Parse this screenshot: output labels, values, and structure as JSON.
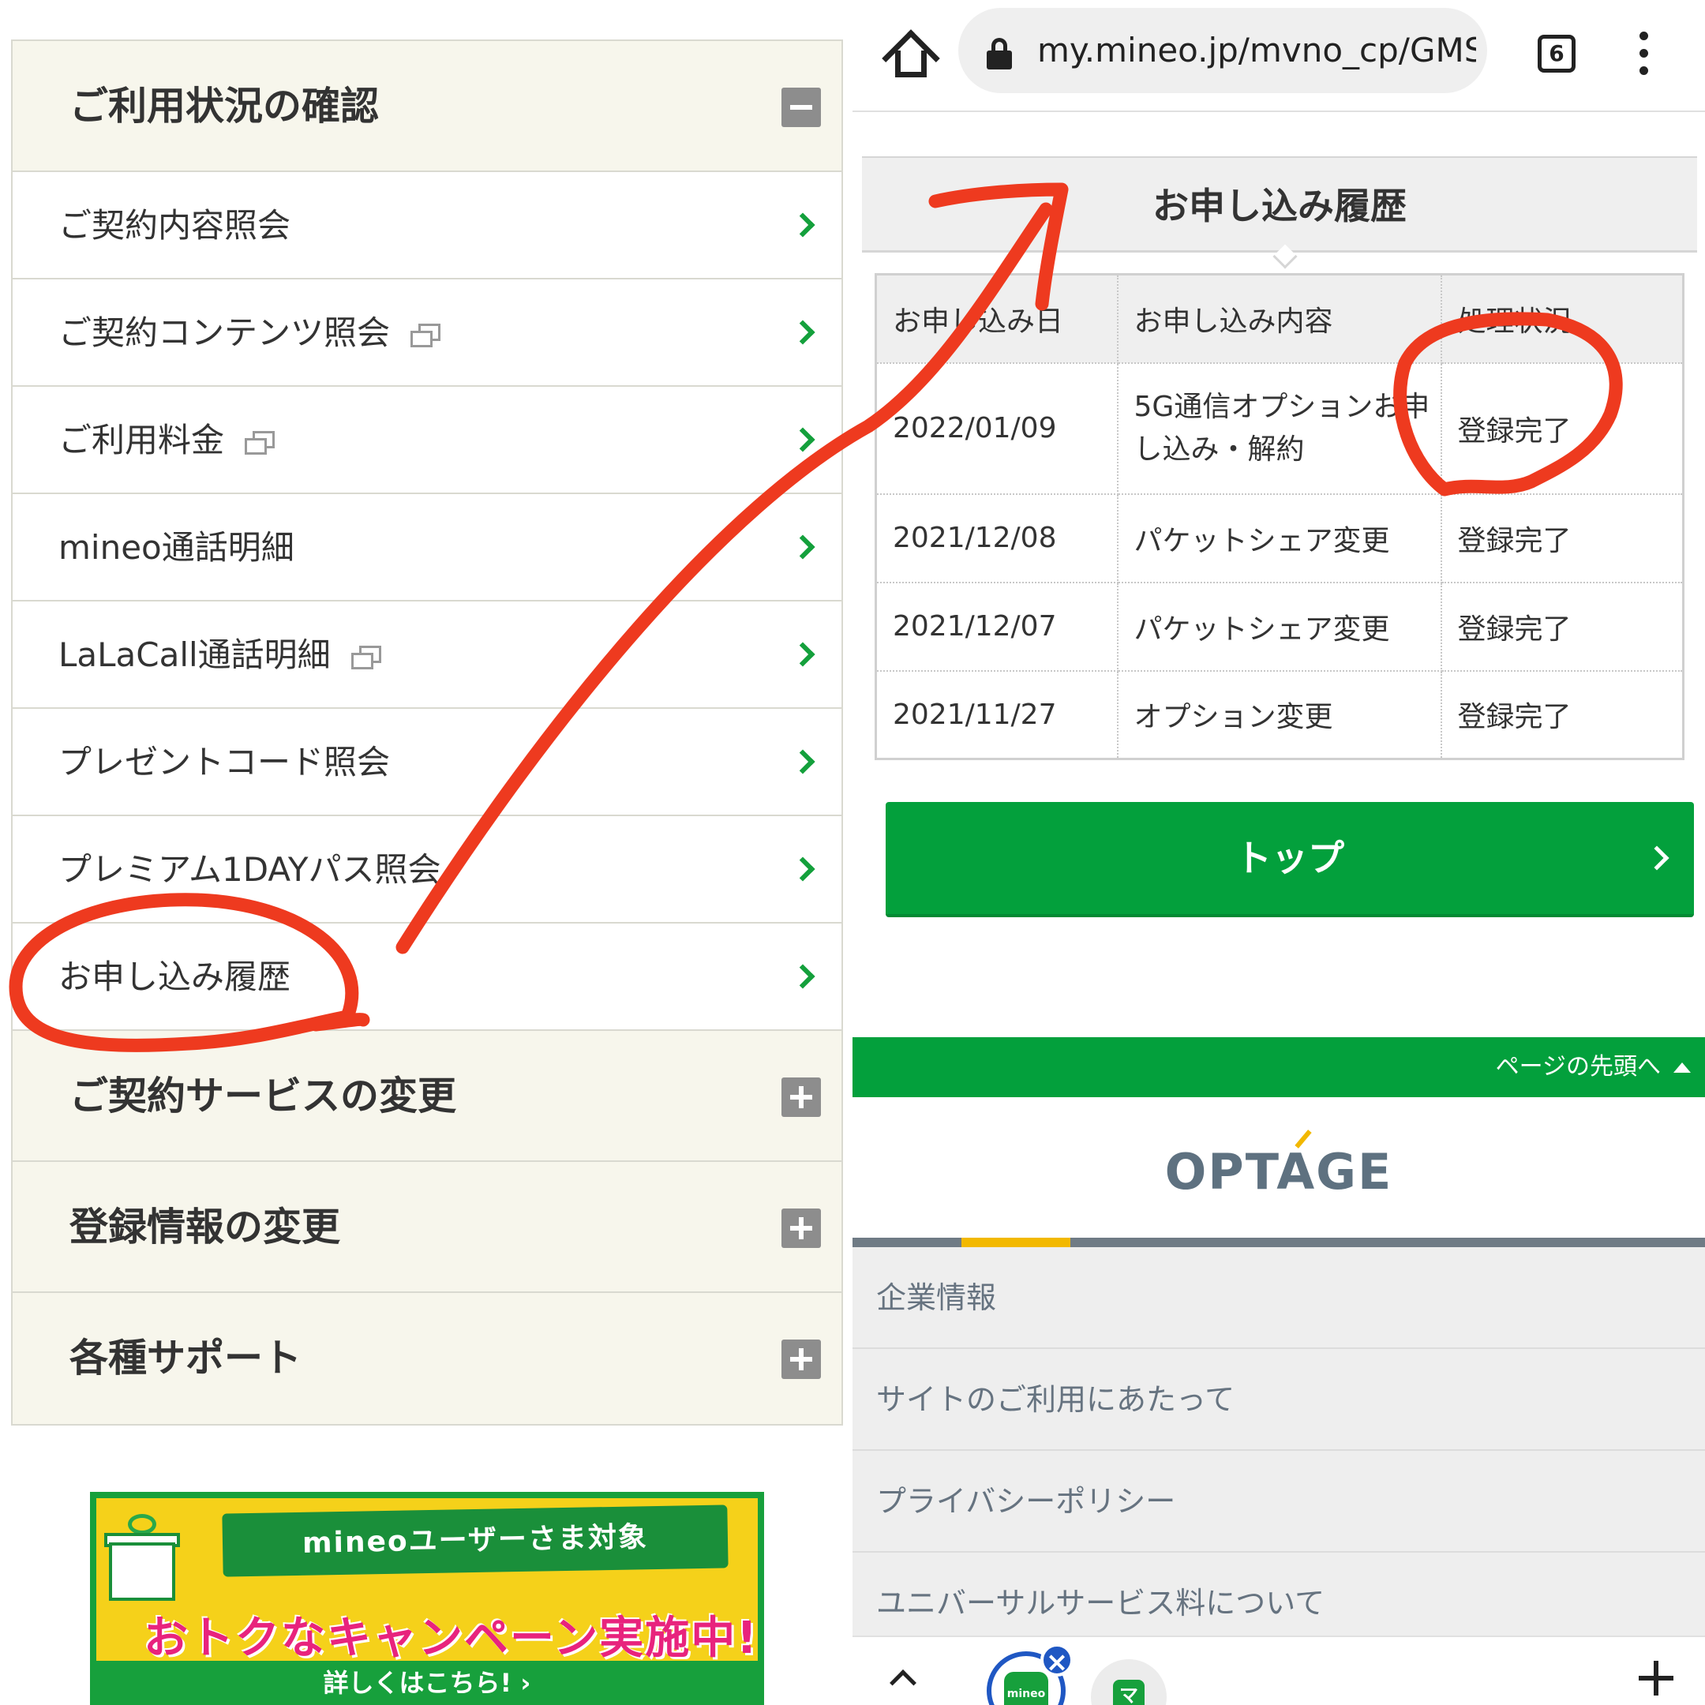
{
  "left_menu": {
    "usage_category": {
      "label": "ご利用状況の確認",
      "state": "collapse"
    },
    "items": [
      {
        "label": "ご契約内容照会",
        "external": false
      },
      {
        "label": "ご契約コンテンツ照会",
        "external": true
      },
      {
        "label": "ご利用料金",
        "external": true
      },
      {
        "label": "mineo通話明細",
        "external": false
      },
      {
        "label": "LaLaCall通話明細",
        "external": true
      },
      {
        "label": "プレゼントコード照会",
        "external": false
      },
      {
        "label": "プレミアム1DAYパス照会",
        "external": false
      },
      {
        "label": "お申し込み履歴",
        "external": false,
        "highlighted": true
      }
    ],
    "categories": [
      {
        "label": "ご契約サービスの変更",
        "state": "expand"
      },
      {
        "label": "登録情報の変更",
        "state": "expand"
      },
      {
        "label": "各種サポート",
        "state": "expand"
      }
    ]
  },
  "banner": {
    "ribbon": "mineoユーザーさま対象",
    "headline": "おトクなキャンペーン実施中!",
    "cta": "詳しくはこちら! ›"
  },
  "browser": {
    "url": "my.mineo.jp/mvno_cp/GMSC",
    "tab_count": "6"
  },
  "history": {
    "title": "お申し込み履歴",
    "columns": [
      "お申し込み日",
      "お申し込み内容",
      "処理状況"
    ],
    "rows": [
      {
        "date": "2022/01/09",
        "content_line1": "5G通信オプションお申",
        "content_line2": "し込み・解約",
        "status": "登録完了",
        "highlighted": true
      },
      {
        "date": "2021/12/08",
        "content": "パケットシェア変更",
        "status": "登録完了"
      },
      {
        "date": "2021/12/07",
        "content": "パケットシェア変更",
        "status": "登録完了"
      },
      {
        "date": "2021/11/27",
        "content": "オプション変更",
        "status": "登録完了"
      }
    ],
    "top_button": "トップ"
  },
  "page_top": "ページの先頭へ",
  "footer": {
    "logo": "OPTAGE",
    "links": [
      "企業情報",
      "サイトのご利用にあたって",
      "プライバシーポリシー",
      "ユニバーサルサービス料について"
    ]
  },
  "bottom_tabs": {
    "mineo_icon": "mineo",
    "close_glyph": "×",
    "other_icon": "マ"
  },
  "annotation_color": "#ee3a1f",
  "brand_green": "#03a03c"
}
